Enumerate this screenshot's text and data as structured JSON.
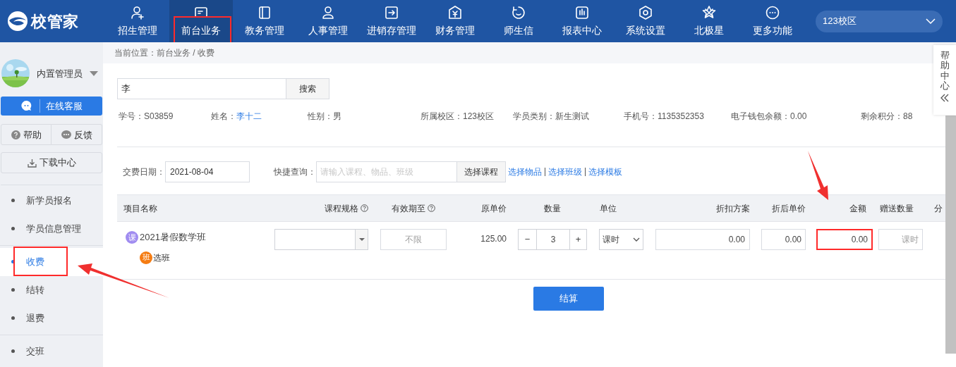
{
  "app": {
    "logo": "校管家"
  },
  "nav": [
    {
      "label": "招生管理",
      "selected": false,
      "highlighted": false
    },
    {
      "label": "前台业务",
      "selected": true,
      "highlighted": true
    },
    {
      "label": "教务管理",
      "selected": false,
      "highlighted": false
    },
    {
      "label": "人事管理",
      "selected": false,
      "highlighted": false
    },
    {
      "label": "进销存管理",
      "selected": false,
      "highlighted": false
    },
    {
      "label": "财务管理",
      "selected": false,
      "highlighted": false
    },
    {
      "label": "师生信",
      "selected": false,
      "highlighted": false
    },
    {
      "label": "报表中心",
      "selected": false,
      "highlighted": false
    },
    {
      "label": "系统设置",
      "selected": false,
      "highlighted": false
    },
    {
      "label": "北极星",
      "selected": false,
      "highlighted": false
    },
    {
      "label": "更多功能",
      "selected": false,
      "highlighted": false
    }
  ],
  "campus_select": {
    "value": "123校区"
  },
  "user": {
    "name": "内置管理员"
  },
  "sidebar": {
    "service_button": "在线客服",
    "help_button": "帮助",
    "feedback_button": "反馈",
    "download_button": "下载中心",
    "groups": [
      {
        "items": [
          {
            "label": "新学员报名",
            "selected": false,
            "highlighted": false,
            "arrow": false
          },
          {
            "label": "学员信息管理",
            "selected": false,
            "highlighted": false,
            "arrow": false
          }
        ]
      },
      {
        "items": [
          {
            "label": "收费",
            "selected": true,
            "highlighted": true,
            "arrow": true
          },
          {
            "label": "结转",
            "selected": false,
            "highlighted": false,
            "arrow": false
          },
          {
            "label": "退费",
            "selected": false,
            "highlighted": false,
            "arrow": false
          }
        ]
      },
      {
        "items": [
          {
            "label": "交班",
            "selected": false,
            "highlighted": false,
            "arrow": false
          }
        ]
      }
    ]
  },
  "breadcrumb": "当前位置：前台业务 / 收费",
  "help_center": {
    "label": "帮助中心"
  },
  "search": {
    "value": "李",
    "button": "搜索"
  },
  "student": [
    {
      "label": "学号：",
      "value": "S03859",
      "kind": "text"
    },
    {
      "label": "姓名：",
      "value": "李十二",
      "kind": "link"
    },
    {
      "label": "性别：",
      "value": "男",
      "kind": "text"
    },
    {
      "label": "所属校区：",
      "value": "123校区",
      "kind": "text"
    },
    {
      "label": "学员类别：",
      "value": "新生测试",
      "kind": "text"
    },
    {
      "label": "手机号：",
      "value": "1135352353",
      "kind": "text"
    },
    {
      "label": "电子钱包余额：",
      "value": "0.00",
      "kind": "text"
    },
    {
      "label": "剩余积分：",
      "value": "88",
      "kind": "text"
    }
  ],
  "fee_date": {
    "label": "交费日期：",
    "value": "2021-08-04"
  },
  "quick_search": {
    "label": "快捷查询：",
    "placeholder": "请输入课程、物品、班级",
    "button": "选择课程",
    "links": [
      "选择物品",
      "选择班级",
      "选择模板"
    ]
  },
  "table": {
    "columns": [
      {
        "label": "项目名称",
        "help": false
      },
      {
        "label": "课程规格",
        "help": true
      },
      {
        "label": "有效期至",
        "help": true
      },
      {
        "label": "原单价",
        "help": false
      },
      {
        "label": "数量",
        "help": false
      },
      {
        "label": "单位",
        "help": false
      },
      {
        "label": "折扣方案",
        "help": false
      },
      {
        "label": "折后单价",
        "help": false
      },
      {
        "label": "金额",
        "help": false
      },
      {
        "label": "赠送数量",
        "help": false
      },
      {
        "label": "分",
        "help": false
      }
    ],
    "rows": [
      {
        "badge": "课",
        "name": "2021暑假数学班",
        "class_badge": "班",
        "class_action": "选班",
        "valid_until_placeholder": "不限",
        "unit_price": "125.00",
        "decrement": "−",
        "quantity": "3",
        "increment": "+",
        "unit": "课时",
        "discount": "0.00",
        "discounted_price": "0.00",
        "amount": {
          "value": "0.00",
          "highlighted": true,
          "arrow": true
        },
        "gift_placeholder": "课时"
      }
    ]
  },
  "submit_button": "结算"
}
